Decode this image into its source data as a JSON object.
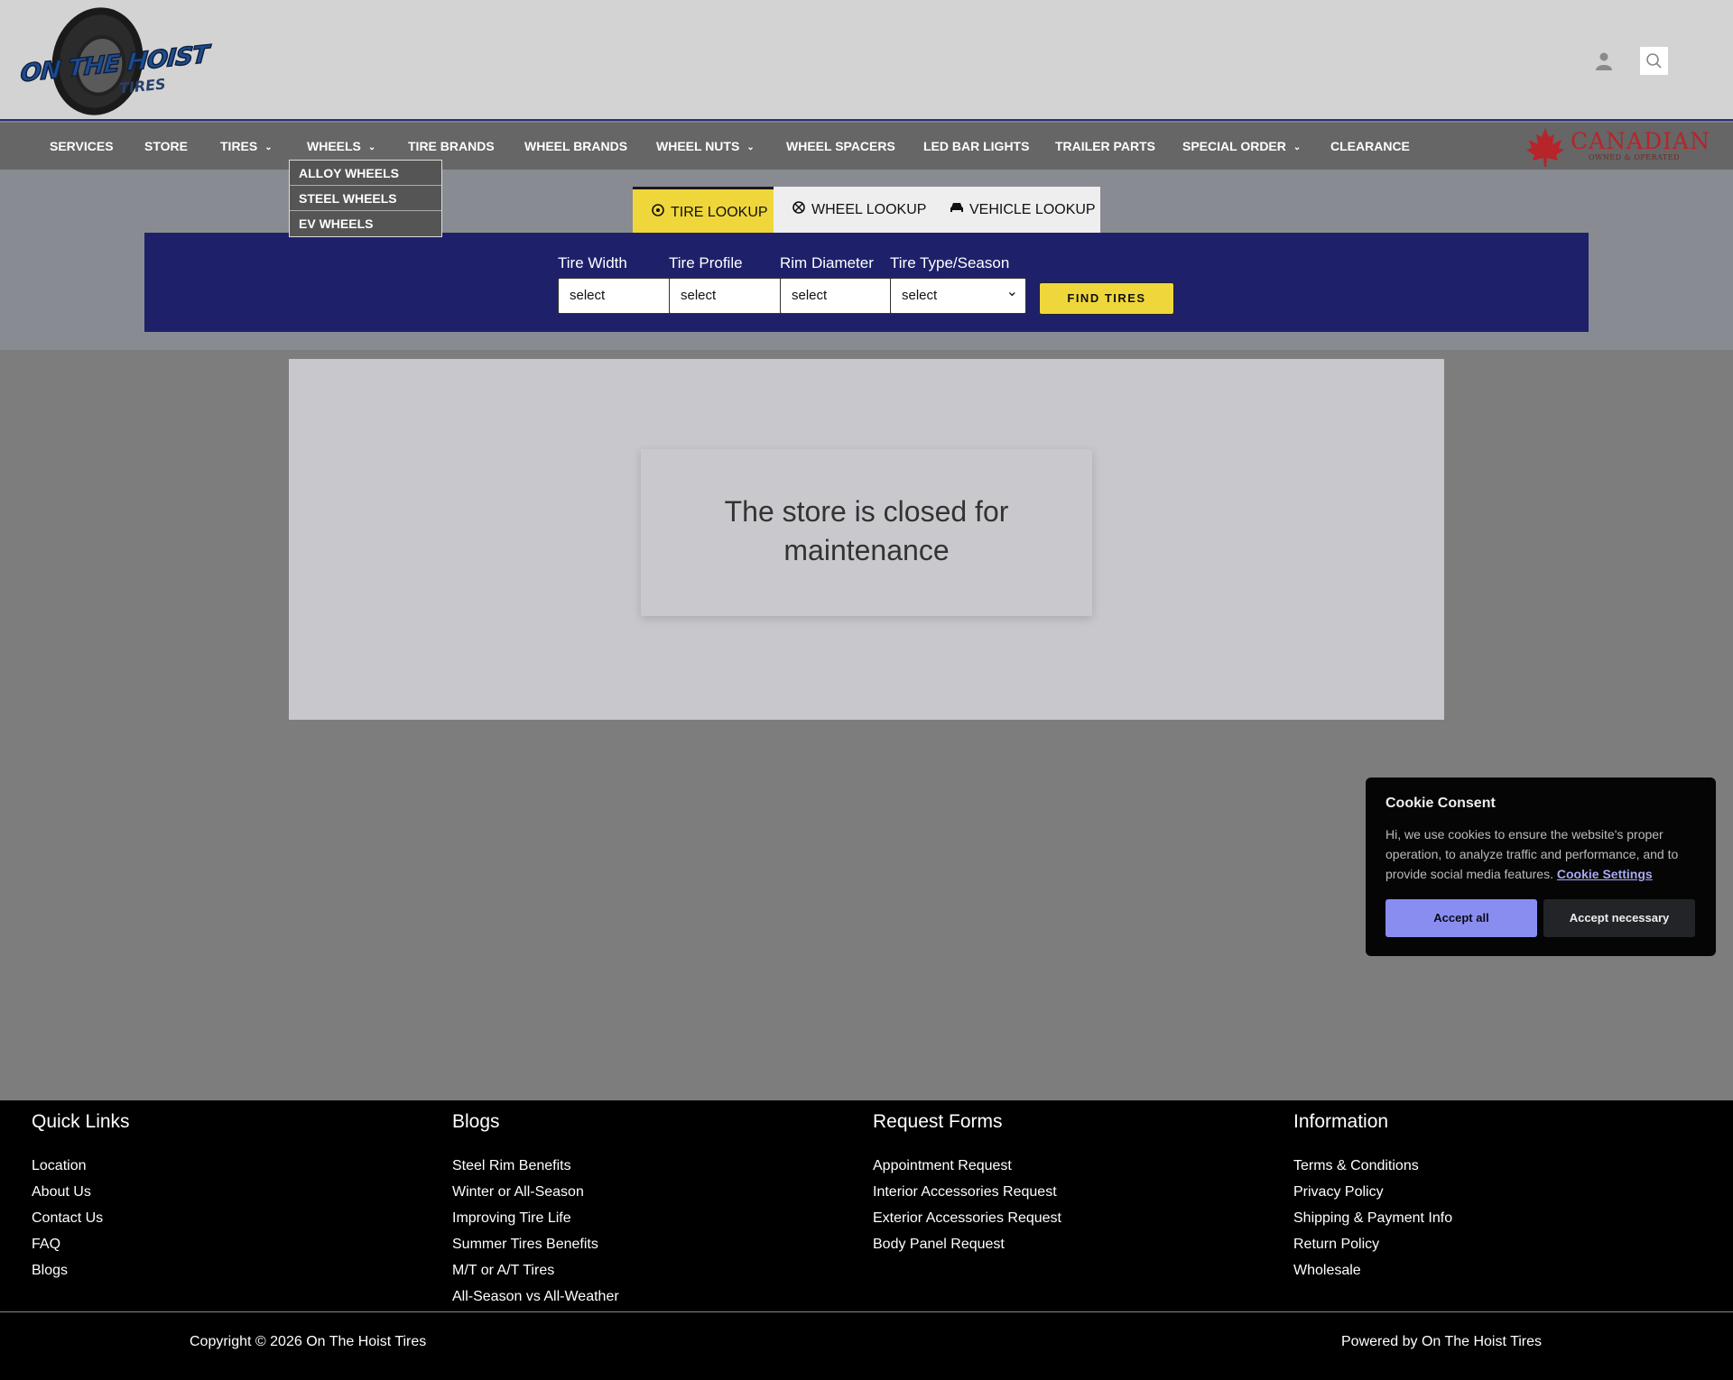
{
  "brand": {
    "logo_text": "ON THE HOIST",
    "logo_sub": "TIRES"
  },
  "header_icons": {
    "account": "user-icon",
    "search": "search-icon"
  },
  "nav": {
    "items": [
      {
        "label": "SERVICES",
        "has_dropdown": false
      },
      {
        "label": "STORE",
        "has_dropdown": false
      },
      {
        "label": "TIRES",
        "has_dropdown": true
      },
      {
        "label": "WHEELS",
        "has_dropdown": true
      },
      {
        "label": "TIRE BRANDS",
        "has_dropdown": false
      },
      {
        "label": "WHEEL BRANDS",
        "has_dropdown": false
      },
      {
        "label": "WHEEL NUTS",
        "has_dropdown": true
      },
      {
        "label": "WHEEL SPACERS",
        "has_dropdown": false
      },
      {
        "label": "LED BAR LIGHTS",
        "has_dropdown": false
      },
      {
        "label": "TRAILER PARTS",
        "has_dropdown": false
      },
      {
        "label": "SPECIAL ORDER",
        "has_dropdown": true
      },
      {
        "label": "CLEARANCE",
        "has_dropdown": false
      }
    ],
    "badge": {
      "word": "CANADIAN",
      "sub": "OWNED & OPERATED"
    }
  },
  "wheels_dropdown": [
    "ALLOY WHEELS",
    "STEEL WHEELS",
    "EV WHEELS"
  ],
  "lookup": {
    "tabs": [
      {
        "label": "TIRE LOOKUP",
        "icon": "tire-icon",
        "active": true
      },
      {
        "label": "WHEEL LOOKUP",
        "icon": "wheel-icon",
        "active": false
      },
      {
        "label": "VEHICLE LOOKUP",
        "icon": "car-icon",
        "active": false
      }
    ],
    "fields": [
      {
        "label": "Tire Width",
        "value": "select"
      },
      {
        "label": "Tire Profile",
        "value": "select"
      },
      {
        "label": "Rim Diameter",
        "value": "select"
      },
      {
        "label": "Tire Type/Season",
        "value": "select"
      }
    ],
    "button": "FIND TIRES"
  },
  "main": {
    "message": "The store is closed for maintenance"
  },
  "cookie": {
    "title": "Cookie Consent",
    "text": "Hi, we use cookies to ensure the website's proper operation, to analyze traffic and performance, and to provide social media features.",
    "link": "Cookie Settings",
    "accept_all": "Accept all",
    "accept_necessary": "Accept necessary"
  },
  "footer": {
    "columns": [
      {
        "title": "Quick Links",
        "links": [
          "Location",
          "About Us",
          "Contact Us",
          "FAQ",
          "Blogs"
        ]
      },
      {
        "title": "Blogs",
        "links": [
          "Steel Rim Benefits",
          "Winter or All-Season",
          "Improving Tire Life",
          "Summer Tires Benefits",
          "M/T or A/T Tires",
          "All-Season vs All-Weather"
        ]
      },
      {
        "title": "Request Forms",
        "links": [
          "Appointment Request",
          "Interior Accessories Request",
          "Exterior Accessories Request",
          "Body Panel Request"
        ]
      },
      {
        "title": "Information",
        "links": [
          "Terms & Conditions",
          "Privacy Policy",
          "Shipping & Payment Info",
          "Return Policy",
          "Wholesale"
        ]
      }
    ],
    "copyright": "Copyright © 2026 On The Hoist Tires",
    "powered": "Powered by On The Hoist Tires"
  },
  "colors": {
    "accent_yellow": "#efd73b",
    "navy": "#1e216a",
    "cookie_primary": "#8a8df0",
    "canadian_red": "#b7242a"
  }
}
